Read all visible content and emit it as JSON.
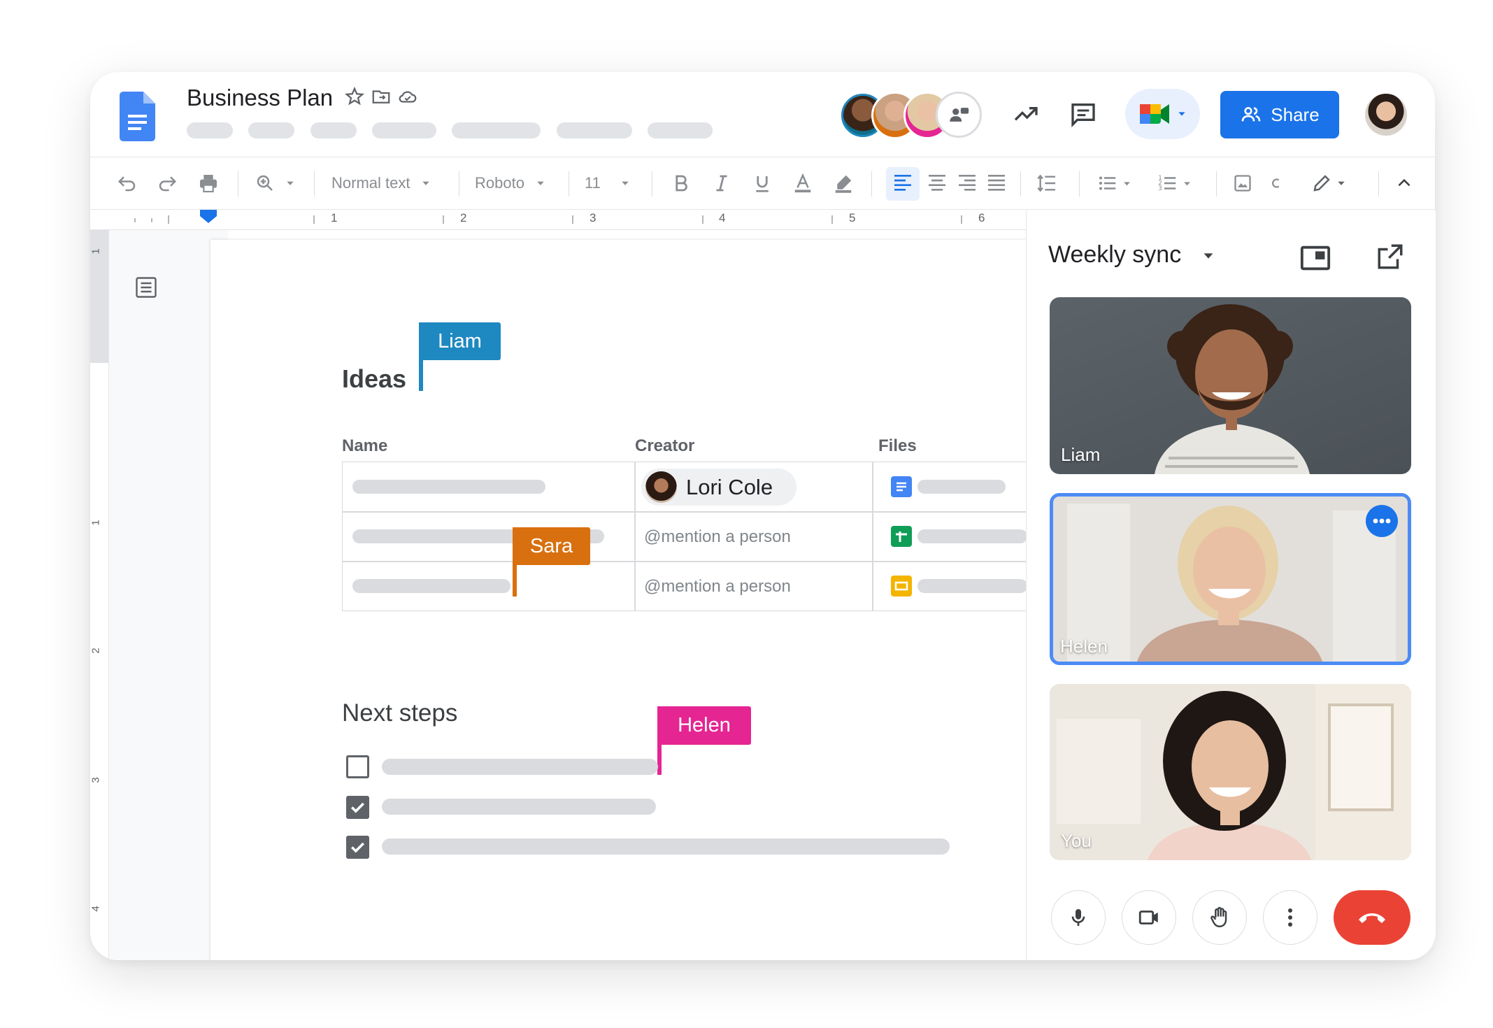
{
  "document": {
    "title": "Business Plan",
    "heading_ideas": "Ideas",
    "heading_next_steps": "Next steps",
    "table": {
      "columns": [
        "Name",
        "Creator",
        "Files"
      ],
      "rows": [
        {
          "creator": "Lori Cole",
          "file_type": "docs"
        },
        {
          "creator": "@mention a person",
          "file_type": "sheets"
        },
        {
          "creator": "@mention a person",
          "file_type": "slides"
        }
      ]
    },
    "checklist": [
      {
        "checked": false
      },
      {
        "checked": true
      },
      {
        "checked": true
      }
    ]
  },
  "header": {
    "share_label": "Share",
    "icons": [
      "star-icon",
      "move-folder-icon",
      "cloud-saved-icon",
      "trending-icon",
      "comments-icon",
      "meet-icon",
      "share-icon"
    ]
  },
  "toolbar": {
    "style": "Normal text",
    "font": "Roboto",
    "size": "11"
  },
  "ruler": {
    "h_numbers": [
      "1",
      "2",
      "3",
      "4",
      "5",
      "6"
    ],
    "v_numbers": [
      "1",
      "1",
      "2",
      "3",
      "4"
    ]
  },
  "cursors": [
    {
      "name": "Liam",
      "color": "#1e88c0"
    },
    {
      "name": "Sara",
      "color": "#d9700f"
    },
    {
      "name": "Helen",
      "color": "#e52592"
    }
  ],
  "meet": {
    "title": "Weekly sync",
    "participants": [
      "Liam",
      "Helen",
      "You"
    ],
    "active_speaker": "Helen"
  },
  "colors": {
    "share_blue": "#1a73e8",
    "hangup_red": "#ea4335"
  }
}
